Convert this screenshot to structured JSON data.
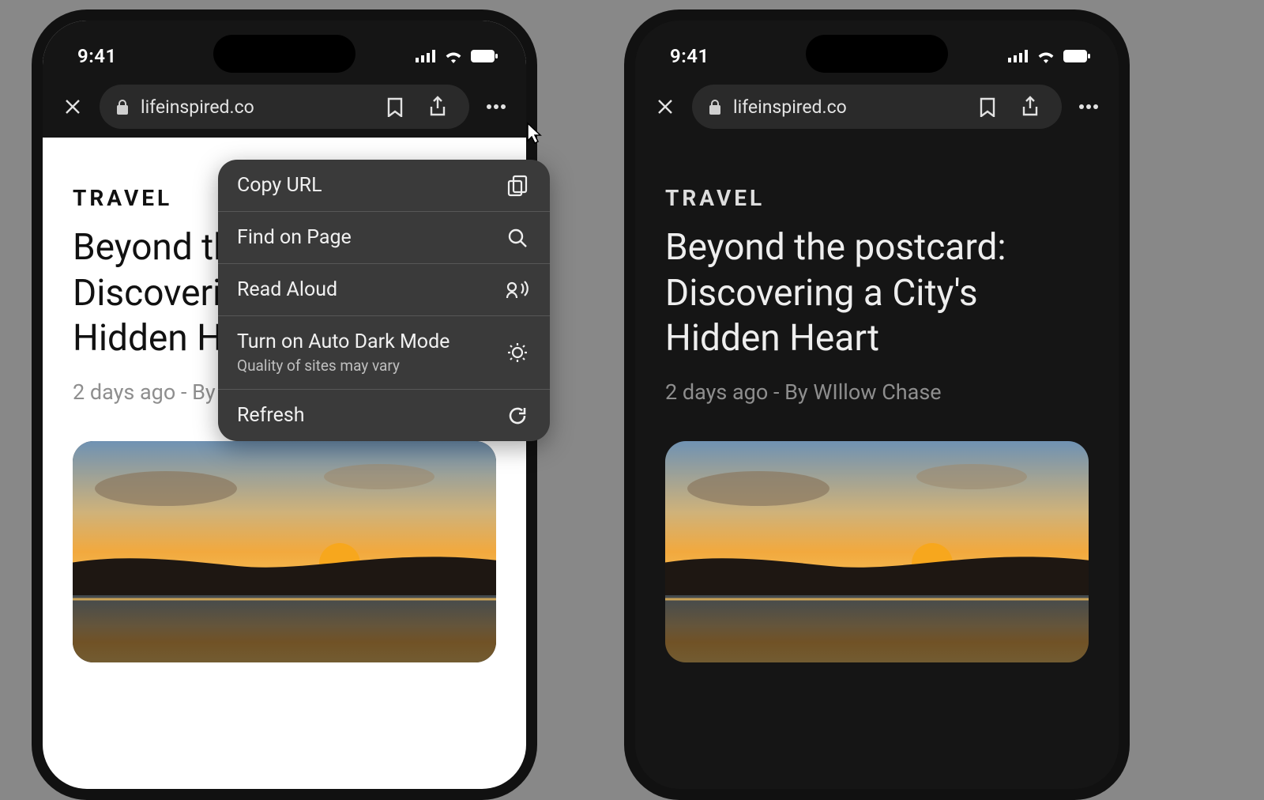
{
  "status": {
    "time": "9:41"
  },
  "toolbar": {
    "url": "lifeinspired.co"
  },
  "article": {
    "category": "TRAVEL",
    "headline": "Beyond the postcard: Discovering a City's Hidden Heart",
    "byline": "2 days ago - By WIllow Chase"
  },
  "menu": {
    "copy_url": "Copy URL",
    "find": "Find on Page",
    "read_aloud": "Read Aloud",
    "dark_mode": "Turn on Auto Dark Mode",
    "dark_mode_sub": "Quality of sites may vary",
    "refresh": "Refresh"
  }
}
